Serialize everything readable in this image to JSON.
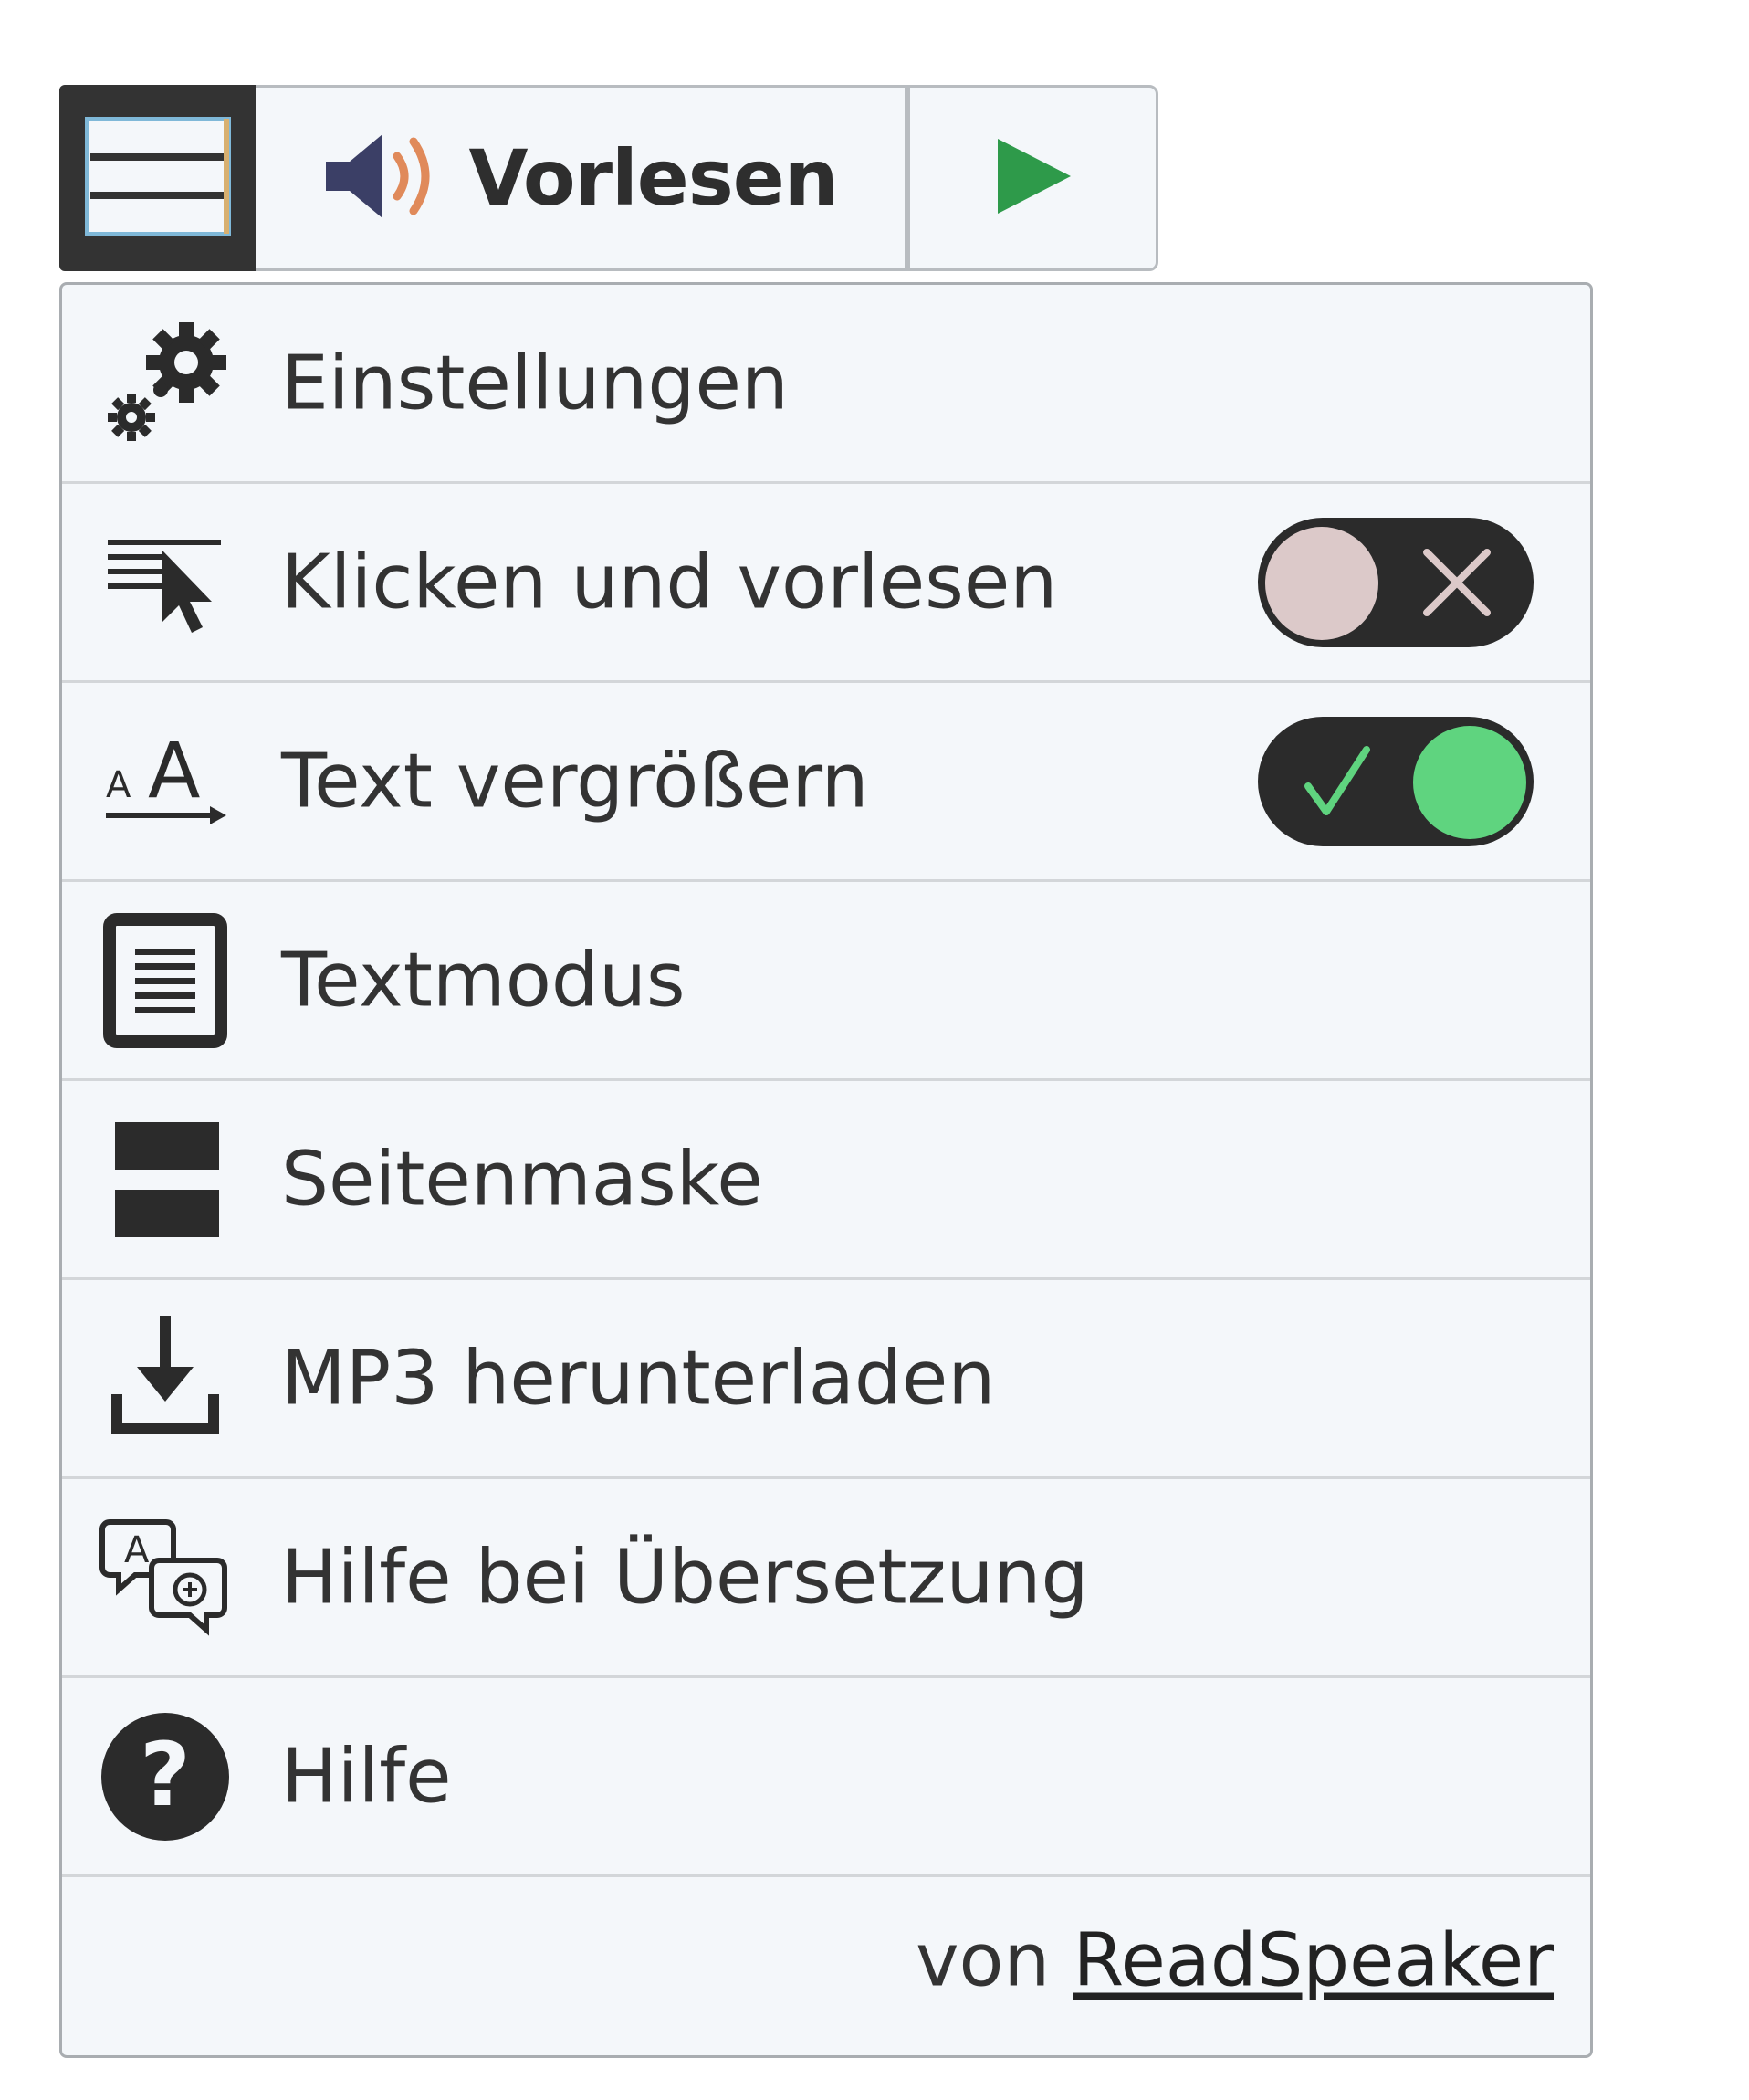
{
  "toolbar": {
    "menu_icon": "hamburger-menu-icon",
    "listen_icon": "speaker-icon",
    "listen_label": "Vorlesen",
    "play_icon": "play-icon"
  },
  "menu": {
    "items": [
      {
        "label": "Einstellungen",
        "icon": "settings-gears-icon"
      },
      {
        "label": "Klicken und vorlesen",
        "icon": "click-and-listen-icon",
        "toggle": "off"
      },
      {
        "label": "Text vergrößern",
        "icon": "text-enlarge-icon",
        "toggle": "on"
      },
      {
        "label": "Textmodus",
        "icon": "text-mode-icon"
      },
      {
        "label": "Seitenmaske",
        "icon": "page-mask-icon"
      },
      {
        "label": "MP3 herunterladen",
        "icon": "download-icon"
      },
      {
        "label": "Hilfe bei Übersetzung",
        "icon": "translation-icon"
      },
      {
        "label": "Hilfe",
        "icon": "help-icon"
      }
    ],
    "footer_prefix": "von",
    "footer_link": "ReadSpeaker"
  },
  "colors": {
    "menu_button_bg": "#333333",
    "panel_bg": "#f4f7fa",
    "play_green": "#2e9a4a",
    "toggle_on_knob": "#5fd47f",
    "toggle_off_knob": "#dcc9c9",
    "speaker_blue": "#3b3f66",
    "speaker_wave": "#e08a5a"
  }
}
